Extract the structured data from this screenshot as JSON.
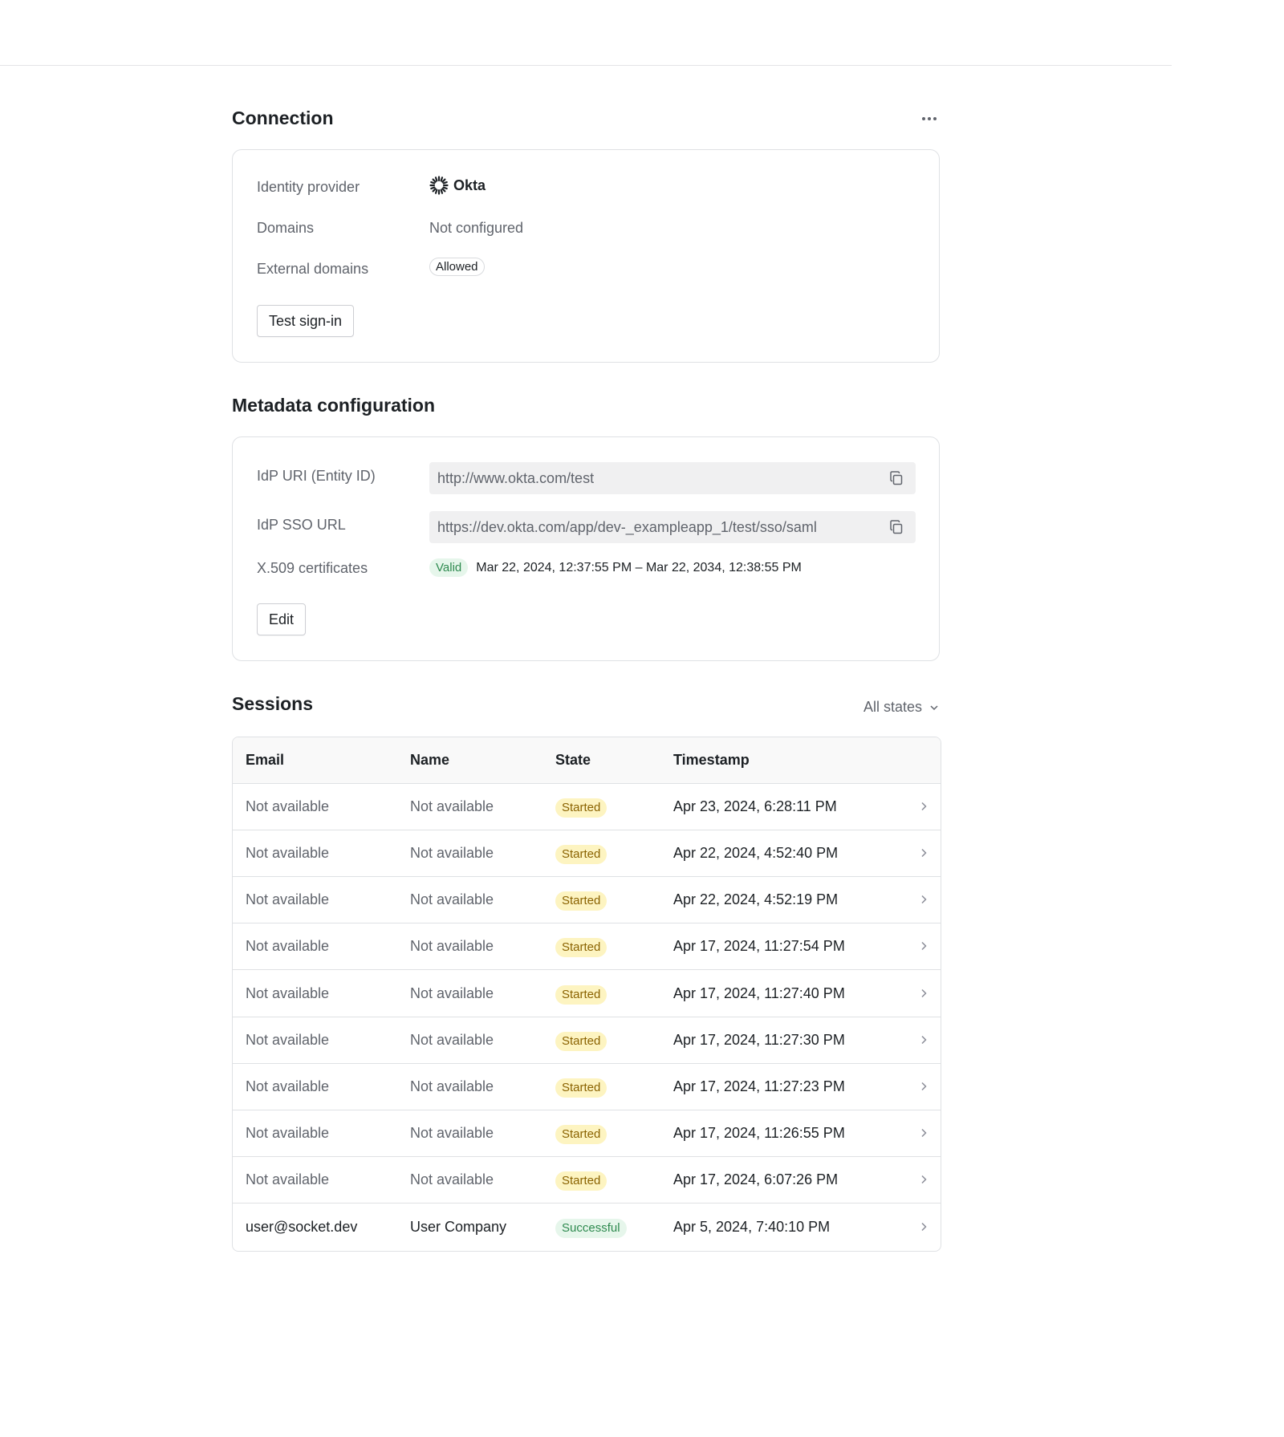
{
  "connection": {
    "title": "Connection",
    "identity_provider_label": "Identity provider",
    "identity_provider_value": "Okta",
    "domains_label": "Domains",
    "domains_value": "Not configured",
    "external_domains_label": "External domains",
    "external_domains_value": "Allowed",
    "test_button_label": "Test sign-in"
  },
  "metadata": {
    "title": "Metadata configuration",
    "idp_uri_label": "IdP URI (Entity ID)",
    "idp_uri_value": "http://www.okta.com/test",
    "idp_sso_label": "IdP SSO URL",
    "idp_sso_value": "https://dev.okta.com/app/dev-_exampleapp_1/test/sso/saml",
    "cert_label": "X.509 certificates",
    "cert_status": "Valid",
    "cert_dates": "Mar 22, 2024, 12:37:55 PM – Mar 22, 2034, 12:38:55 PM",
    "edit_button_label": "Edit"
  },
  "sessions": {
    "title": "Sessions",
    "filter_label": "All states",
    "columns": [
      "Email",
      "Name",
      "State",
      "Timestamp"
    ],
    "rows": [
      {
        "email": "Not available",
        "name": "Not available",
        "state": "Started",
        "timestamp": "Apr 23, 2024, 6:28:11 PM"
      },
      {
        "email": "Not available",
        "name": "Not available",
        "state": "Started",
        "timestamp": "Apr 22, 2024, 4:52:40 PM"
      },
      {
        "email": "Not available",
        "name": "Not available",
        "state": "Started",
        "timestamp": "Apr 22, 2024, 4:52:19 PM"
      },
      {
        "email": "Not available",
        "name": "Not available",
        "state": "Started",
        "timestamp": "Apr 17, 2024, 11:27:54 PM"
      },
      {
        "email": "Not available",
        "name": "Not available",
        "state": "Started",
        "timestamp": "Apr 17, 2024, 11:27:40 PM"
      },
      {
        "email": "Not available",
        "name": "Not available",
        "state": "Started",
        "timestamp": "Apr 17, 2024, 11:27:30 PM"
      },
      {
        "email": "Not available",
        "name": "Not available",
        "state": "Started",
        "timestamp": "Apr 17, 2024, 11:27:23 PM"
      },
      {
        "email": "Not available",
        "name": "Not available",
        "state": "Started",
        "timestamp": "Apr 17, 2024, 11:26:55 PM"
      },
      {
        "email": "Not available",
        "name": "Not available",
        "state": "Started",
        "timestamp": "Apr 17, 2024, 6:07:26 PM"
      },
      {
        "email": "user@socket.dev",
        "name": "User Company",
        "state": "Successful",
        "timestamp": "Apr 5, 2024, 7:40:10 PM"
      }
    ]
  },
  "icons": {
    "more": "more-horizontal-icon",
    "okta": "okta-logo-icon",
    "copy": "copy-icon",
    "filter_chevron": "chevron-down-icon",
    "row_chevron": "chevron-right-icon"
  },
  "colors": {
    "started_badge_bg": "#fdf4c1",
    "started_badge_text": "#8a6200",
    "success_badge_bg": "#e6f6eb",
    "success_badge_text": "#2e8a4f"
  }
}
